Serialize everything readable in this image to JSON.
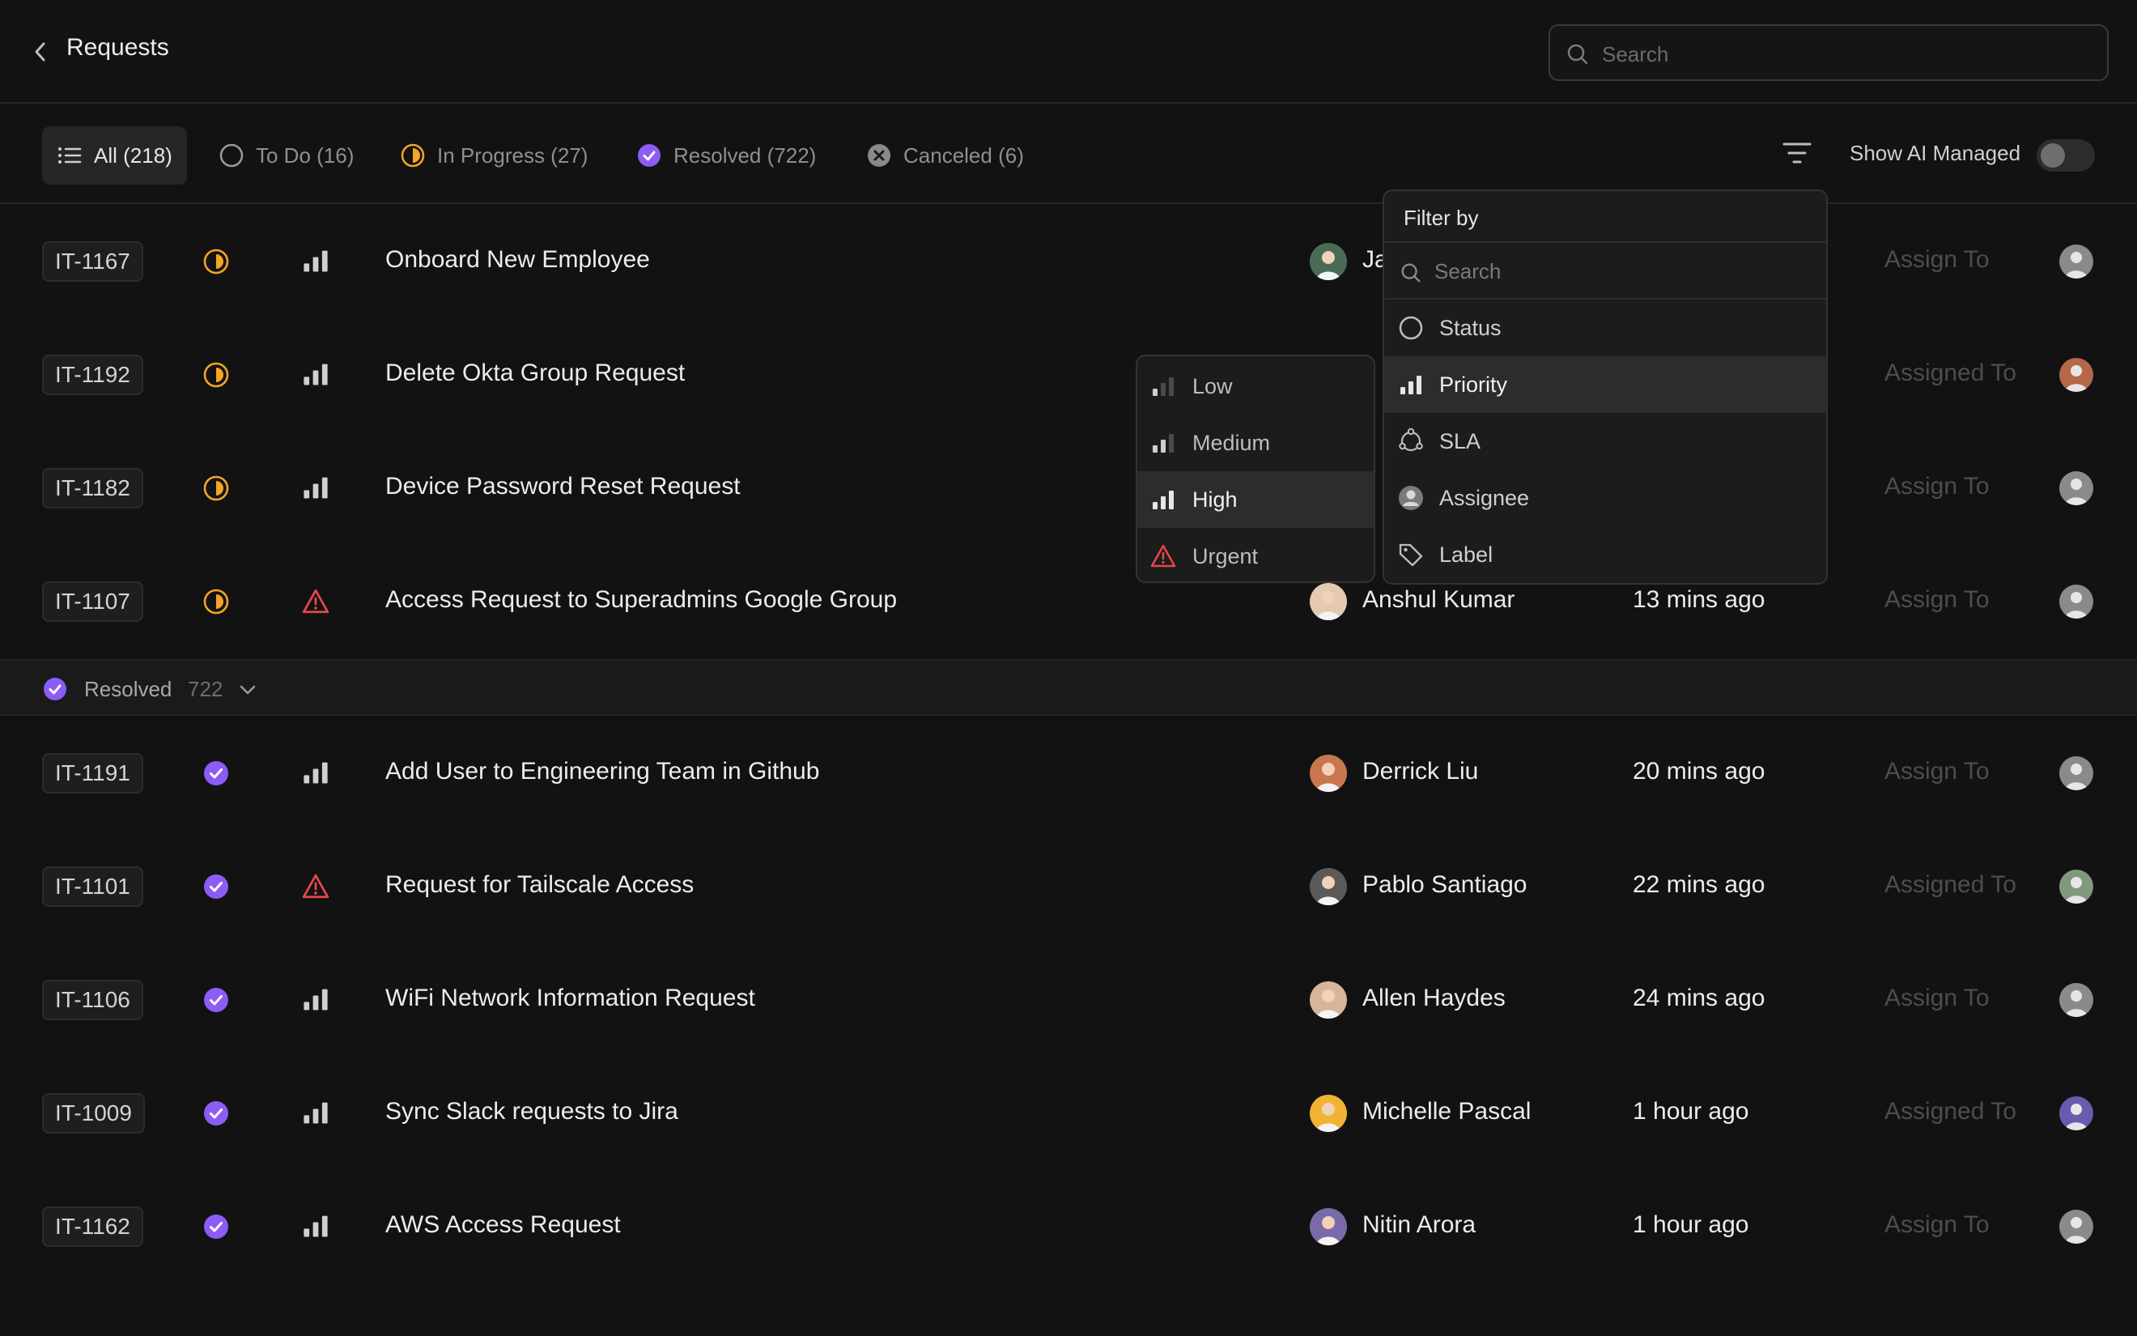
{
  "header": {
    "title": "Requests",
    "search_placeholder": "Search"
  },
  "tabs": [
    {
      "label": "All (218)",
      "icon": "list-icon",
      "active": true
    },
    {
      "label": "To Do (16)",
      "icon": "circle-icon"
    },
    {
      "label": "In Progress (27)",
      "icon": "half-circle-icon"
    },
    {
      "label": "Resolved (722)",
      "icon": "check-circle-icon"
    },
    {
      "label": "Canceled (6)",
      "icon": "x-circle-icon"
    }
  ],
  "toolbar": {
    "ai_label": "Show AI Managed",
    "ai_enabled": false
  },
  "colors": {
    "in_progress": "#f5a524",
    "resolved": "#8b5cf6",
    "urgent": "#e5484d",
    "background": "#121212"
  },
  "rows": [
    {
      "id": "IT-1167",
      "status": "in-progress",
      "priority": "high",
      "title": "Onboard New Employee",
      "person": "Ja",
      "time": "",
      "assign": "Assign To"
    },
    {
      "id": "IT-1192",
      "status": "in-progress",
      "priority": "high",
      "title": "Delete Okta Group Request",
      "person": "",
      "time": "",
      "assign": "Assigned To"
    },
    {
      "id": "IT-1182",
      "status": "in-progress",
      "priority": "high",
      "title": "Device Password Reset Request",
      "person": "",
      "time": "",
      "assign": "Assign To"
    },
    {
      "id": "IT-1107",
      "status": "in-progress",
      "priority": "urgent",
      "title": "Access Request to Superadmins Google Group",
      "person": "Anshul Kumar",
      "time": "13 mins ago",
      "assign": "Assign To"
    },
    {
      "id": "IT-1191",
      "status": "resolved",
      "priority": "high",
      "title": "Add User to Engineering Team in Github",
      "person": "Derrick Liu",
      "time": "20 mins ago",
      "assign": "Assign To"
    },
    {
      "id": "IT-1101",
      "status": "resolved",
      "priority": "urgent",
      "title": "Request for Tailscale Access",
      "person": "Pablo Santiago",
      "time": "22 mins ago",
      "assign": "Assigned To"
    },
    {
      "id": "IT-1106",
      "status": "resolved",
      "priority": "high",
      "title": "WiFi Network Information Request",
      "person": "Allen Haydes",
      "time": "24 mins ago",
      "assign": "Assign To"
    },
    {
      "id": "IT-1009",
      "status": "resolved",
      "priority": "high",
      "title": "Sync Slack requests to Jira",
      "person": "Michelle Pascal",
      "time": "1 hour ago",
      "assign": "Assigned To"
    },
    {
      "id": "IT-1162",
      "status": "resolved",
      "priority": "high",
      "title": "AWS Access Request",
      "person": "Nitin Arora",
      "time": "1 hour ago",
      "assign": "Assign To"
    }
  ],
  "section": {
    "label": "Resolved",
    "count": "722"
  },
  "filter_menu": {
    "title": "Filter by",
    "search_placeholder": "Search",
    "items": [
      {
        "label": "Status",
        "icon": "circle-icon"
      },
      {
        "label": "Priority",
        "icon": "signal-bars-icon",
        "highlighted": true
      },
      {
        "label": "SLA",
        "icon": "sla-icon"
      },
      {
        "label": "Assignee",
        "icon": "user-icon"
      },
      {
        "label": "Label",
        "icon": "tag-icon"
      }
    ]
  },
  "priority_menu": {
    "items": [
      {
        "label": "Low",
        "icon": "priority-low-icon"
      },
      {
        "label": "Medium",
        "icon": "priority-medium-icon"
      },
      {
        "label": "High",
        "icon": "priority-high-icon",
        "highlighted": true
      },
      {
        "label": "Urgent",
        "icon": "warning-icon"
      }
    ]
  }
}
